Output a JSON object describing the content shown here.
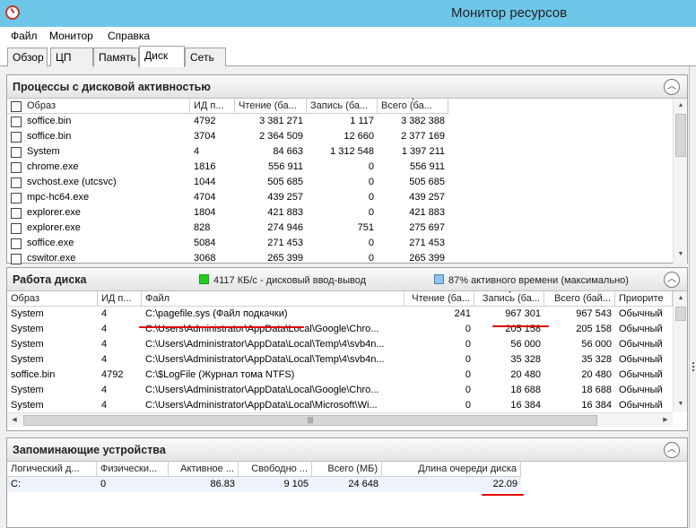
{
  "window": {
    "title": "Монитор ресурсов"
  },
  "menu": {
    "file": "Файл",
    "monitor": "Монитор",
    "help": "Справка"
  },
  "tabs": {
    "overview": "Обзор",
    "cpu": "ЦП",
    "memory": "Память",
    "disk": "Диск",
    "network": "Сеть"
  },
  "processes": {
    "title": "Процессы с дисковой активностью",
    "headers": {
      "image": "Образ",
      "pid": "ИД п...",
      "read": "Чтение (ба...",
      "write": "Запись (ба...",
      "total": "Всего (ба..."
    },
    "rows": [
      {
        "image": "soffice.bin",
        "pid": "4792",
        "read": "3 381 271",
        "write": "1 117",
        "total": "3 382 388"
      },
      {
        "image": "soffice.bin",
        "pid": "3704",
        "read": "2 364 509",
        "write": "12 660",
        "total": "2 377 169"
      },
      {
        "image": "System",
        "pid": "4",
        "read": "84 663",
        "write": "1 312 548",
        "total": "1 397 211"
      },
      {
        "image": "chrome.exe",
        "pid": "1816",
        "read": "556 911",
        "write": "0",
        "total": "556 911"
      },
      {
        "image": "svchost.exe (utcsvc)",
        "pid": "1044",
        "read": "505 685",
        "write": "0",
        "total": "505 685"
      },
      {
        "image": "mpc-hc64.exe",
        "pid": "4704",
        "read": "439 257",
        "write": "0",
        "total": "439 257"
      },
      {
        "image": "explorer.exe",
        "pid": "1804",
        "read": "421 883",
        "write": "0",
        "total": "421 883"
      },
      {
        "image": "explorer.exe",
        "pid": "828",
        "read": "274 946",
        "write": "751",
        "total": "275 697"
      },
      {
        "image": "soffice.exe",
        "pid": "5084",
        "read": "271 453",
        "write": "0",
        "total": "271 453"
      },
      {
        "image": "cswitor.exe",
        "pid": "3068",
        "read": "265 399",
        "write": "0",
        "total": "265 399"
      }
    ]
  },
  "disk_activity": {
    "title": "Работа диска",
    "io_legend": "4117 КБ/с - дисковый ввод-вывод",
    "active_legend": "87% активного времени (максимально)",
    "io_color": "#22cc22",
    "active_color": "#8ec3f0",
    "headers": {
      "image": "Образ",
      "pid": "ИД п...",
      "file": "Файл",
      "read": "Чтение (ба...",
      "write": "Запись (ба...",
      "total": "Всего (бай...",
      "priority": "Приорите"
    },
    "rows": [
      {
        "image": "System",
        "pid": "4",
        "file": "C:\\pagefile.sys (Файл подкачки)",
        "read": "241",
        "write": "967 301",
        "total": "967 543",
        "priority": "Обычный"
      },
      {
        "image": "System",
        "pid": "4",
        "file": "C:\\Users\\Administrator\\AppData\\Local\\Google\\Chro...",
        "read": "0",
        "write": "205 158",
        "total": "205 158",
        "priority": "Обычный"
      },
      {
        "image": "System",
        "pid": "4",
        "file": "C:\\Users\\Administrator\\AppData\\Local\\Temp\\4\\svb4n...",
        "read": "0",
        "write": "56 000",
        "total": "56 000",
        "priority": "Обычный"
      },
      {
        "image": "System",
        "pid": "4",
        "file": "C:\\Users\\Administrator\\AppData\\Local\\Temp\\4\\svb4n...",
        "read": "0",
        "write": "35 328",
        "total": "35 328",
        "priority": "Обычный"
      },
      {
        "image": "soffice.bin",
        "pid": "4792",
        "file": "C:\\$LogFile (Журнал тома NTFS)",
        "read": "0",
        "write": "20 480",
        "total": "20 480",
        "priority": "Обычный"
      },
      {
        "image": "System",
        "pid": "4",
        "file": "C:\\Users\\Administrator\\AppData\\Local\\Google\\Chro...",
        "read": "0",
        "write": "18 688",
        "total": "18 688",
        "priority": "Обычный"
      },
      {
        "image": "System",
        "pid": "4",
        "file": "C:\\Users\\Administrator\\AppData\\Local\\Microsoft\\Wi...",
        "read": "0",
        "write": "16 384",
        "total": "16 384",
        "priority": "Обычный"
      }
    ]
  },
  "storage": {
    "title": "Запоминающие устройства",
    "headers": {
      "logical": "Логический д...",
      "physical": "Физически...",
      "active": "Активное ...",
      "free": "Свободно ...",
      "total": "Всего (МБ)",
      "queue": "Длина очереди диска"
    },
    "rows": [
      {
        "logical": "C:",
        "physical": "0",
        "active": "86.83",
        "free": "9 105",
        "total": "24 648",
        "queue": "22.09"
      }
    ]
  },
  "colors": {
    "titlebar": "#6ec6e8",
    "annotation": "#e00000"
  }
}
